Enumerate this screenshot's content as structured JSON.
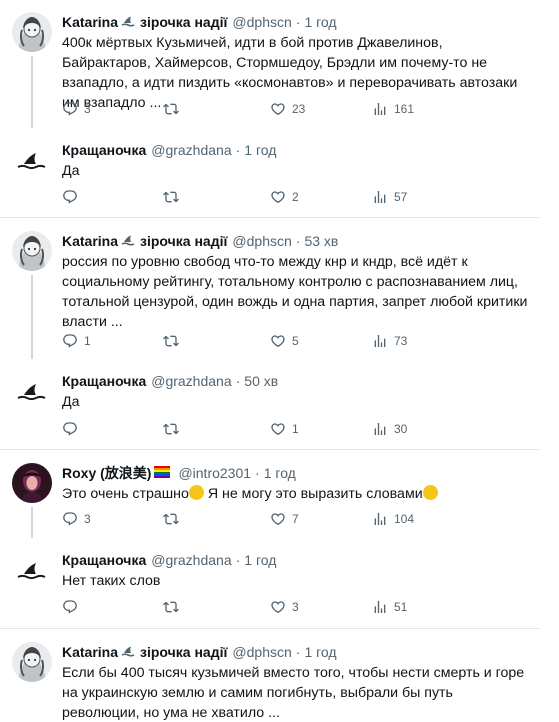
{
  "tweets": [
    {
      "author": "Katarina",
      "tag": "зірочка надії",
      "handle": "@dphscn",
      "time": "1 год",
      "text": "400к мёртвых Кузьмичей, идти в бой против Джавелинов, Байрактаров, Хаймерсов, Стормшедоу, Брэдли им почему-то не взападло, а идти пиздить «космонавтов» и переворачивать автозаки им взападло ...",
      "replies": "3",
      "retweets": "",
      "likes": "23",
      "views": "161"
    },
    {
      "author": "Кращаночка",
      "handle": "@grazhdana",
      "time": "1 год",
      "text": "Да",
      "replies": "",
      "retweets": "",
      "likes": "2",
      "views": "57"
    },
    {
      "author": "Katarina",
      "tag": "зірочка надії",
      "handle": "@dphscn",
      "time": "53 хв",
      "text": "россия по уровню свобод что-то между кнр и кндр, всё идёт к социальному рейтингу, тотальному контролю с распознаванием лиц, тотальной цензурой, один вождь и одна партия, запрет любой критики власти ...",
      "replies": "1",
      "retweets": "",
      "likes": "5",
      "views": "73"
    },
    {
      "author": "Кращаночка",
      "handle": "@grazhdana",
      "time": "50 хв",
      "text": "Да",
      "replies": "",
      "retweets": "",
      "likes": "1",
      "views": "30"
    },
    {
      "author": "Roxy (放浪美)",
      "flag": "🏳️‍🌈",
      "handle": "@intro2301",
      "time": "1 год",
      "text_a": "Это очень страшно",
      "text_b": " Я не могу это выразить словами",
      "replies": "3",
      "retweets": "",
      "likes": "7",
      "views": "104"
    },
    {
      "author": "Кращаночка",
      "handle": "@grazhdana",
      "time": "1 год",
      "text": "Нет таких слов",
      "replies": "",
      "retweets": "",
      "likes": "3",
      "views": "51"
    },
    {
      "author": "Katarina",
      "tag": "зірочка надії",
      "handle": "@dphscn",
      "time": "1 год",
      "text": "Если бы 400 тысяч кузьмичей вместо того, чтобы нести смерть и горе на украинскую землю и самим погибнуть, выбрали бы путь революции, но ума не хватило ...",
      "replies": "",
      "retweets": "",
      "likes": "",
      "views": ""
    }
  ],
  "sep": "·",
  "icons": {
    "reply": "reply-icon",
    "retweet": "retweet-icon",
    "like": "heart-icon",
    "views": "views-icon",
    "shark": "shark-fin-icon"
  },
  "colors": {
    "text": "#0f1419",
    "secondary": "#536471",
    "divider": "#e4e8eb",
    "thread": "#cfd9de"
  }
}
